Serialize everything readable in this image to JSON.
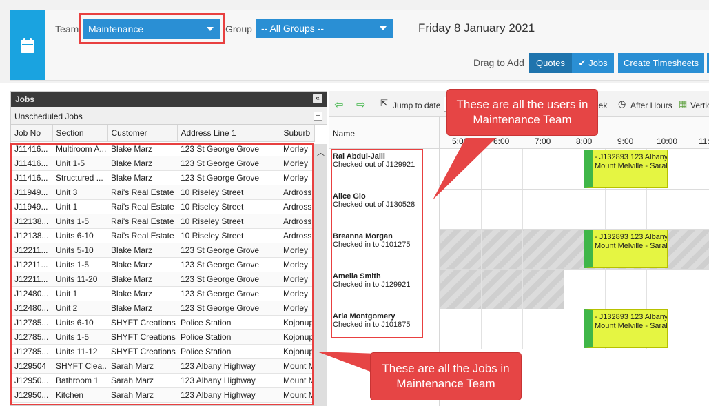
{
  "header": {
    "team_label": "Team",
    "team_value": "Maintenance",
    "group_label": "Group",
    "group_value": "-- All Groups --",
    "date": "Friday 8 January 2021",
    "drag_to_add": "Drag to Add",
    "quotes_button": "Quotes",
    "jobs_button": "Jobs",
    "create_timesheets_button": "Create Timesheets"
  },
  "jobs_panel": {
    "title": "Jobs",
    "section": "Unscheduled Jobs",
    "columns": [
      "Job No",
      "Section",
      "Customer",
      "Address Line 1",
      "Suburb"
    ],
    "rows": [
      [
        "J11416...",
        "Multiroom A...",
        "Blake Marz",
        "123 St George Grove",
        "Morley"
      ],
      [
        "J11416...",
        "Unit 1-5",
        "Blake Marz",
        "123 St George Grove",
        "Morley"
      ],
      [
        "J11416...",
        "Structured ...",
        "Blake Marz",
        "123 St George Grove",
        "Morley"
      ],
      [
        "J11949...",
        "Unit 3",
        "Rai's Real Estate",
        "10 Riseley Street",
        "Ardross"
      ],
      [
        "J11949...",
        "Unit 1",
        "Rai's Real Estate",
        "10 Riseley Street",
        "Ardross"
      ],
      [
        "J12138...",
        "Units 1-5",
        "Rai's Real Estate",
        "10 Riseley Street",
        "Ardross"
      ],
      [
        "J12138...",
        "Units 6-10",
        "Rai's Real Estate",
        "10 Riseley Street",
        "Ardross"
      ],
      [
        "J12211...",
        "Units 5-10",
        "Blake Marz",
        "123 St George Grove",
        "Morley"
      ],
      [
        "J12211...",
        "Units 1-5",
        "Blake Marz",
        "123 St George Grove",
        "Morley"
      ],
      [
        "J12211...",
        "Units 11-20",
        "Blake Marz",
        "123 St George Grove",
        "Morley"
      ],
      [
        "J12480...",
        "Unit 1",
        "Blake Marz",
        "123 St George Grove",
        "Morley"
      ],
      [
        "J12480...",
        "Unit 2",
        "Blake Marz",
        "123 St George Grove",
        "Morley"
      ],
      [
        "J12785...",
        "Units 6-10",
        "SHYFT Creations",
        "Police Station",
        "Kojonup"
      ],
      [
        "J12785...",
        "Units 1-5",
        "SHYFT Creations",
        "Police Station",
        "Kojonup"
      ],
      [
        "J12785...",
        "Units 11-12",
        "SHYFT Creations",
        "Police Station",
        "Kojonup"
      ],
      [
        "J129504",
        "SHYFT Clea...",
        "Sarah Marz",
        "123 Albany Highway",
        "Mount M"
      ],
      [
        "J12950...",
        "Bathroom 1",
        "Sarah Marz",
        "123 Albany Highway",
        "Mount M"
      ],
      [
        "J12950...",
        "Kitchen",
        "Sarah Marz",
        "123 Albany Highway",
        "Mount M"
      ]
    ]
  },
  "scheduler": {
    "jump_to_date": "Jump to date",
    "week_fragment": "eek",
    "after_hours": "After Hours",
    "vertical_fragment": "Vertic",
    "name_header": "Name",
    "hours": [
      "5:00",
      "6:00",
      "7:00",
      "8:00",
      "9:00",
      "10:00",
      "11:"
    ],
    "users": [
      {
        "name": "Rai Abdul-Jalil",
        "status": "Checked out of J129921"
      },
      {
        "name": "Alice Gio",
        "status": "Checked out of J130528"
      },
      {
        "name": "Breanna Morgan",
        "status": "Checked in to J101275"
      },
      {
        "name": "Amelia Smith",
        "status": "Checked in to J129921"
      },
      {
        "name": "Aria Montgomery",
        "status": "Checked in to J101875"
      }
    ],
    "job_line1": "- J132893 123 Albany",
    "job_line2": "Mount Melville - Sarah"
  },
  "callouts": {
    "users": "These are all the users in Maintenance Team",
    "jobs": "These are all the Jobs in Maintenance Team"
  },
  "colors": {
    "accent_blue": "#2a8fd4",
    "tile_blue": "#1aa3e0",
    "job_yellow": "#e5f542",
    "job_green": "#3fb648",
    "highlight_red": "#e84040"
  }
}
